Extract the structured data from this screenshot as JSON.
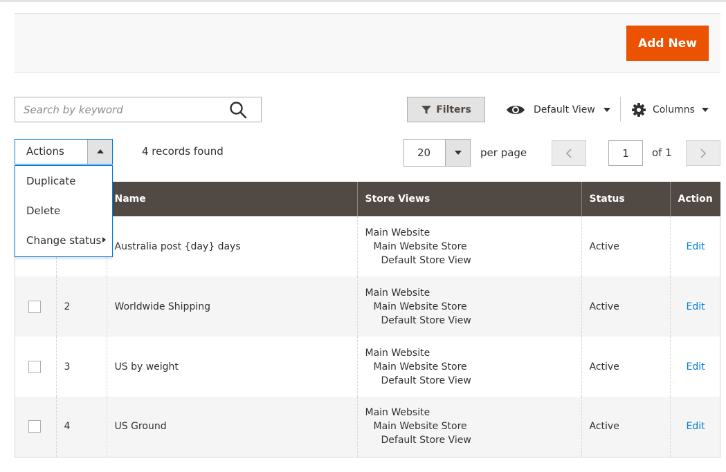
{
  "page_actions": {
    "add_new_label": "Add New"
  },
  "search": {
    "placeholder": "Search by keyword",
    "value": ""
  },
  "toolbar": {
    "filters_label": "Filters",
    "view_label": "Default View",
    "columns_label": "Columns"
  },
  "mass_actions": {
    "label": "Actions",
    "menu": [
      "Duplicate",
      "Delete",
      "Change status"
    ]
  },
  "records_found": "4 records found",
  "pager": {
    "per_page_value": "20",
    "per_page_label": "per page",
    "current_page": "1",
    "of_label": "of 1"
  },
  "table": {
    "headers": [
      "",
      "",
      "Name",
      "Store Views",
      "Status",
      "Action"
    ],
    "rows": [
      {
        "id": "",
        "name": "Australia post {day} days",
        "store_views": [
          "Main Website",
          "Main Website Store",
          "Default Store View"
        ],
        "status": "Active",
        "action": "Edit"
      },
      {
        "id": "2",
        "name": "Worldwide Shipping",
        "store_views": [
          "Main Website",
          "Main Website Store",
          "Default Store View"
        ],
        "status": "Active",
        "action": "Edit"
      },
      {
        "id": "3",
        "name": "US by weight",
        "store_views": [
          "Main Website",
          "Main Website Store",
          "Default Store View"
        ],
        "status": "Active",
        "action": "Edit"
      },
      {
        "id": "4",
        "name": "US Ground",
        "store_views": [
          "Main Website",
          "Main Website Store",
          "Default Store View"
        ],
        "status": "Active",
        "action": "Edit"
      }
    ]
  },
  "colors": {
    "accent": "#eb5202",
    "header_bg": "#514943",
    "link": "#007bdb",
    "focus_border": "#007bdb"
  }
}
